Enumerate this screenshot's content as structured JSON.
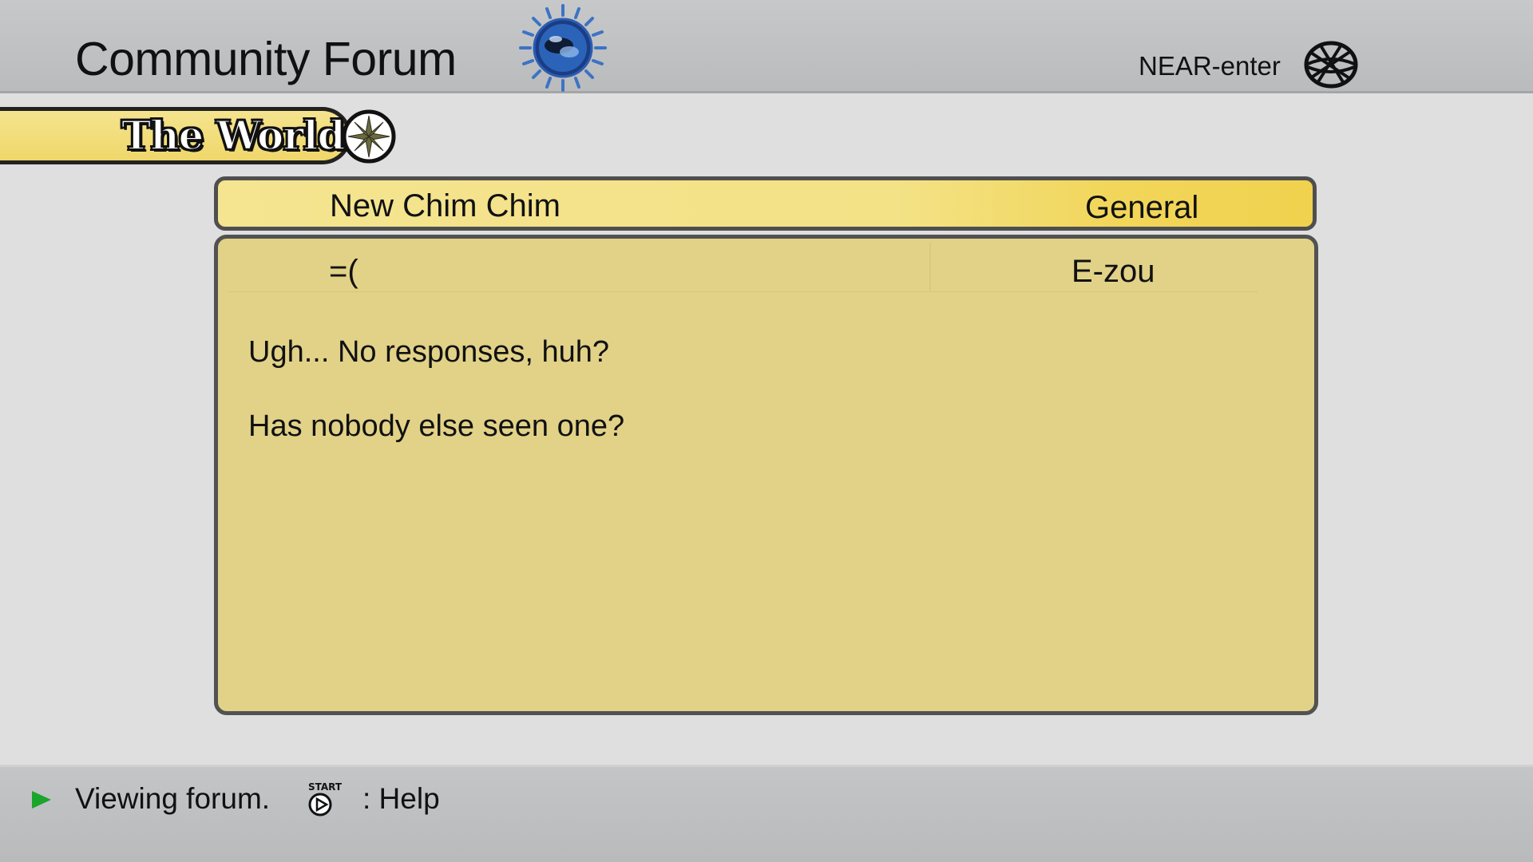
{
  "header": {
    "title": "Community Forum",
    "logo_icon": "globe-logo-icon",
    "location_label": "NEAR-enter",
    "network_icon": "wire-globe-icon"
  },
  "server": {
    "name": "The World",
    "icon": "compass-icon"
  },
  "thread": {
    "title": "New Chim Chim",
    "category": "General"
  },
  "post": {
    "subject": "=(",
    "author": "E-zou",
    "body_lines": [
      "Ugh... No responses, huh?",
      "Has nobody else seen one?"
    ]
  },
  "footer": {
    "status": "Viewing forum.",
    "start_button_label": "START",
    "help_label": ": Help",
    "arrow_icon": "play-arrow-icon"
  },
  "colors": {
    "panel": "#e1d288",
    "header_yellow": "#f5e490",
    "header_gold": "#f0d24e",
    "arrow_green": "#1aa52b",
    "chrome_gray": "#c0c2c4"
  }
}
